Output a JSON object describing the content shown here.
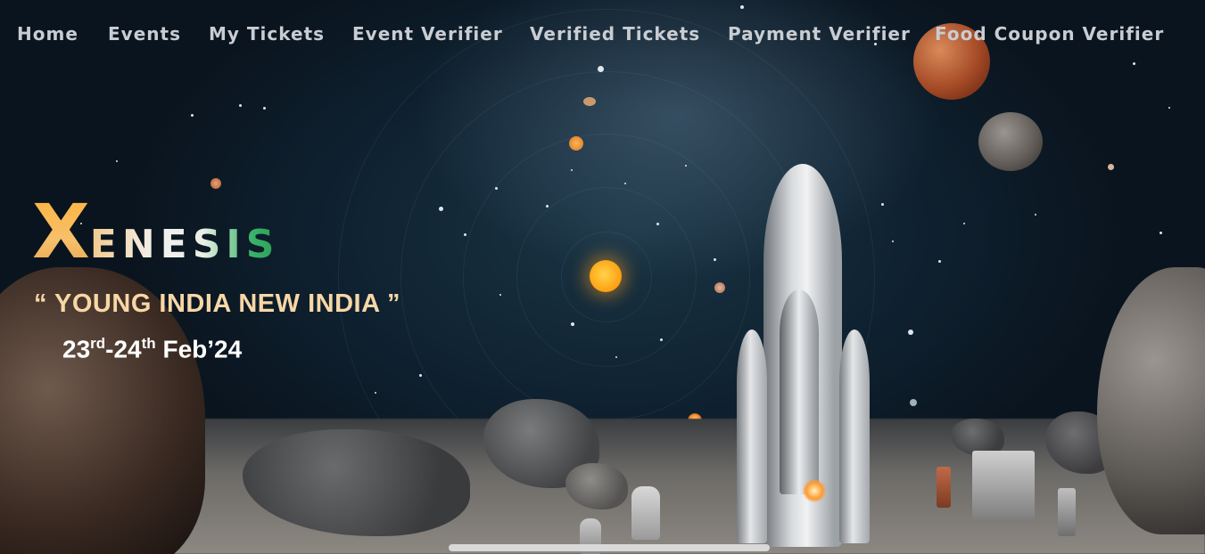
{
  "nav": {
    "items": [
      {
        "label": "Home"
      },
      {
        "label": "Events"
      },
      {
        "label": "My Tickets"
      },
      {
        "label": "Event Verifier"
      },
      {
        "label": "Verified Tickets"
      },
      {
        "label": "Payment Verifier"
      },
      {
        "label": "Food Coupon Verifier"
      }
    ]
  },
  "hero": {
    "brand_initial": "X",
    "brand_rest": "ENESIS",
    "tagline": "“ YOUNG INDIA NEW INDIA ”",
    "dates": {
      "day1": "23",
      "day1_suffix": "rd",
      "separator": "-",
      "day2": "24",
      "day2_suffix": "th",
      "month_year": " Feb’24"
    }
  },
  "colors": {
    "nav_text": "#c9cdd2",
    "tagline": "#f8d7a6",
    "brand_gold": "#ffb23a",
    "brand_green": "#2a9e55",
    "dates": "#ffffff"
  },
  "icons": [
    "rocket-illustration",
    "sun-icon",
    "planet-icon"
  ]
}
